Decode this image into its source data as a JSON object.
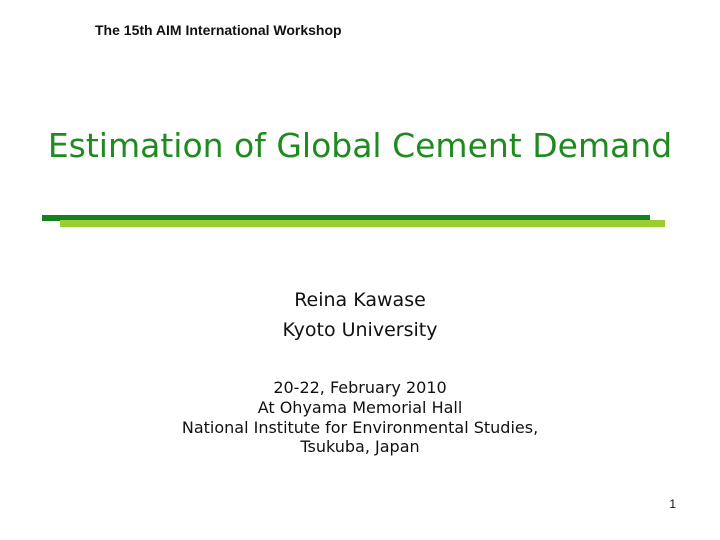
{
  "slide": {
    "header_note": "The 15th AIM International Workshop",
    "title": "Estimation of Global Cement Demand",
    "author": {
      "name": "Reina Kawase",
      "affiliation": "Kyoto University"
    },
    "event": {
      "dates": "20-22, February 2010",
      "venue": "At Ohyama Memorial Hall",
      "institute": "National Institute for Environmental Studies,",
      "location": "Tsukuba, Japan"
    },
    "slide_number": "1"
  },
  "colors": {
    "title_green": "#1f8a1f",
    "rule_dark_green": "#12821c",
    "rule_light_green": "#9acd32"
  }
}
